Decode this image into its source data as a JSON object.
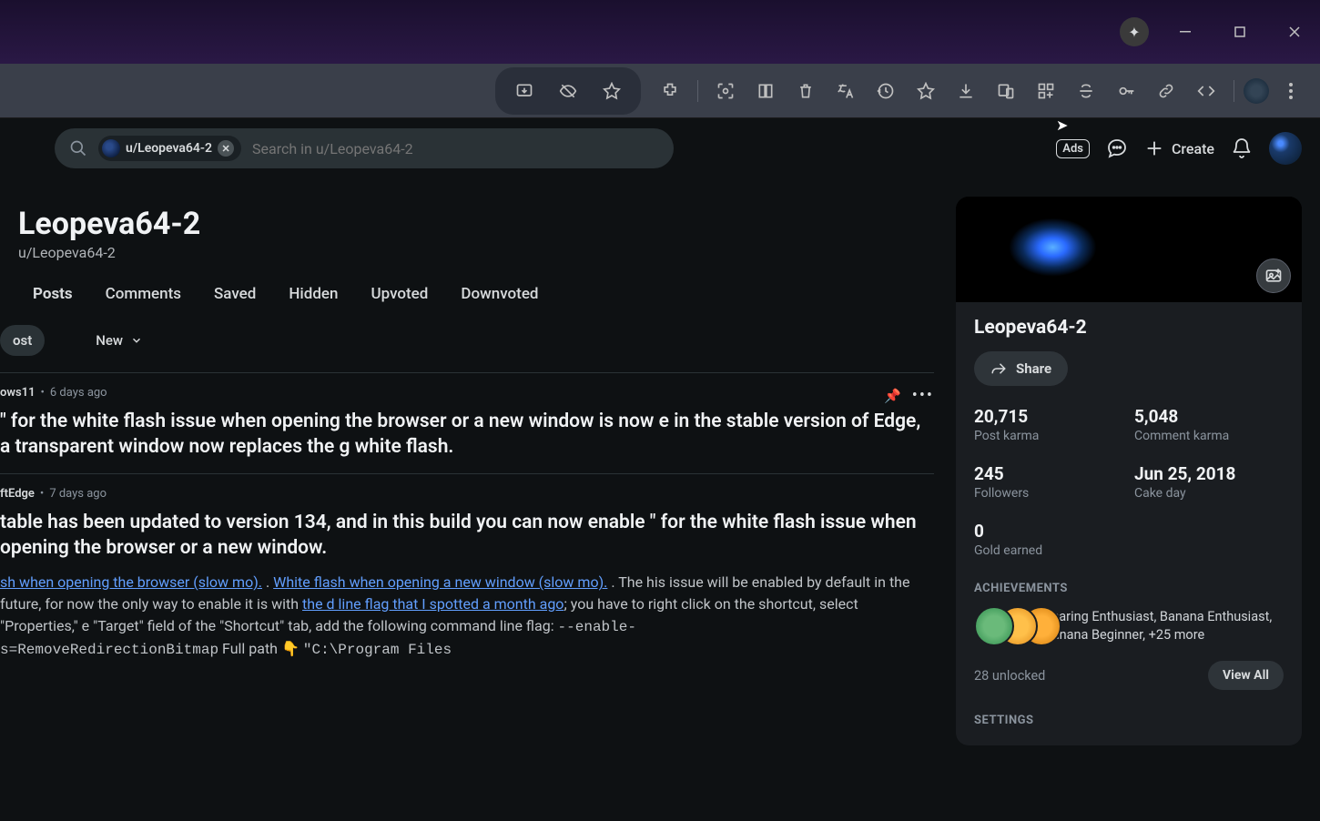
{
  "window": {
    "sparkle": "✦"
  },
  "search": {
    "chip_label": "u/Leopeva64-2",
    "placeholder": "Search in u/Leopeva64-2"
  },
  "header": {
    "ads_label": "Ads",
    "create_label": "Create"
  },
  "profile": {
    "display_name": "Leopeva64-2",
    "username": "u/Leopeva64-2"
  },
  "tabs": {
    "posts": "Posts",
    "comments": "Comments",
    "saved": "Saved",
    "hidden": "Hidden",
    "upvoted": "Upvoted",
    "downvoted": "Downvoted"
  },
  "controls": {
    "create_post": "ost",
    "sort": "New"
  },
  "posts": [
    {
      "sub": "ows11",
      "age": "6 days ago",
      "pinned": true,
      "title": "\" for the white flash issue when opening the browser or a new window is now e in the stable version of Edge, a transparent window now replaces the g white flash."
    },
    {
      "sub": "ftEdge",
      "age": "7 days ago",
      "pinned": false,
      "title": "table has been updated to version 134, and in this build you can now enable \" for the white flash issue when opening the browser or a new window.",
      "body_part1": "sh when opening the browser (slow mo).",
      "body_sep1": " . ",
      "body_link2": "White flash when opening a new window (slow mo).",
      "body_part2": " . The his issue will be enabled by default in the future, for now the only way to enable it is with ",
      "body_link3": "the d line flag that I spotted a month ago",
      "body_part3": "; you have to right click on the shortcut, select \"Properties,\" e \"Target\" field of the \"Shortcut\" tab, add the following command line flag: ",
      "body_code1": "--enable-",
      "body_code2": "s=RemoveRedirectionBitmap",
      "body_part4": " Full path 👇 ",
      "body_code3": "\"C:\\Program Files"
    }
  ],
  "sidebar": {
    "username": "Leopeva64-2",
    "share_label": "Share",
    "stats": {
      "post_karma": {
        "value": "20,715",
        "label": "Post karma"
      },
      "comment_karma": {
        "value": "5,048",
        "label": "Comment karma"
      },
      "followers": {
        "value": "245",
        "label": "Followers"
      },
      "cake_day": {
        "value": "Jun 25, 2018",
        "label": "Cake day"
      },
      "gold": {
        "value": "0",
        "label": "Gold earned"
      }
    },
    "achievements_title": "ACHIEVEMENTS",
    "achievements_text": "Sharing Enthusiast, Banana Enthusiast, Banana Beginner, +25 more",
    "unlocked": "28 unlocked",
    "view_all": "View All",
    "settings_title": "SETTINGS"
  }
}
